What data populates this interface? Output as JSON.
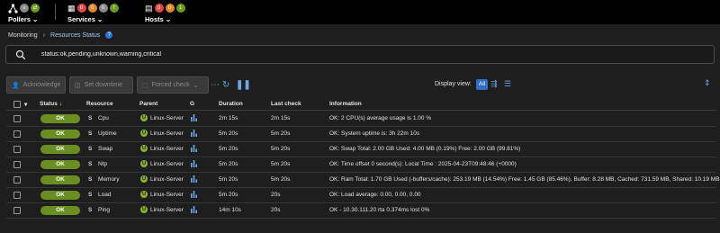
{
  "topbar": {
    "pollers": {
      "label": "Pollers"
    },
    "services": {
      "label": "Services",
      "counts": [
        "0",
        "0",
        "0",
        "7"
      ]
    },
    "hosts": {
      "label": "Hosts",
      "counts": [
        "0",
        "0",
        "1"
      ]
    }
  },
  "breadcrumb": {
    "root": "Monitoring",
    "current": "Resources Status"
  },
  "search": {
    "value": "status:ok,pending,unknown,warning,critical"
  },
  "actions": {
    "acknowledge": "Acknowledge",
    "downtime": "Set downtime",
    "forced_check": "Forced check"
  },
  "display_view": {
    "label": "Display view:",
    "all": "All"
  },
  "table": {
    "headers": {
      "status": "Status",
      "resource": "Resource",
      "parent": "Parent",
      "graph": "G",
      "duration": "Duration",
      "last_check": "Last check",
      "information": "Information"
    },
    "rows": [
      {
        "status": "OK",
        "resource": "Cpu",
        "parent": "Linux-Server",
        "duration": "2m 15s",
        "last_check": "2m 15s",
        "information": "OK: 2 CPU(s) average usage is 1.00 %"
      },
      {
        "status": "OK",
        "resource": "Uptime",
        "parent": "Linux-Server",
        "duration": "5m 20s",
        "last_check": "5m 20s",
        "information": "OK: System uptime is: 3h 22m 10s"
      },
      {
        "status": "OK",
        "resource": "Swap",
        "parent": "Linux-Server",
        "duration": "5m 20s",
        "last_check": "5m 20s",
        "information": "OK: Swap Total: 2.00 GB Used: 4.00 MB (0.19%) Free: 2.00 GB (99.81%)"
      },
      {
        "status": "OK",
        "resource": "Ntp",
        "parent": "Linux-Server",
        "duration": "5m 20s",
        "last_check": "5m 20s",
        "information": "OK: Time offset 0 second(s): Local Time : 2025-04-23T09:48:46 (+0000)"
      },
      {
        "status": "OK",
        "resource": "Memory",
        "parent": "Linux-Server",
        "duration": "5m 20s",
        "last_check": "5m 20s",
        "information": "OK: Ram Total: 1.70 GB Used (-buffers/cache): 253.19 MB (14.54%) Free: 1.45 GB (85.46%), Buffer: 8.28 MB, Cached: 731.59 MB, Shared: 10.19 MB"
      },
      {
        "status": "OK",
        "resource": "Load",
        "parent": "Linux-Server",
        "duration": "5m 20s",
        "last_check": "20s",
        "information": "OK: Load average: 0.00, 0.00, 0.00"
      },
      {
        "status": "OK",
        "resource": "Ping",
        "parent": "Linux-Server",
        "duration": "14m 10s",
        "last_check": "20s",
        "information": "OK - 10.30.111.20 rta 0.374ms lost 0%"
      }
    ]
  }
}
